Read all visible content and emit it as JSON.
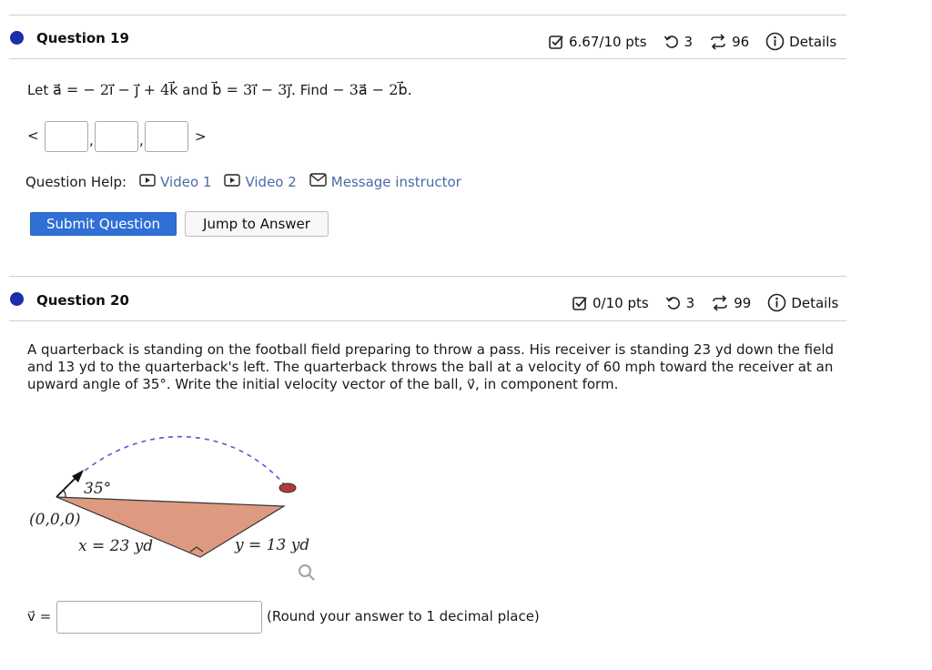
{
  "question19": {
    "title": "Question 19",
    "score": "6.67/10 pts",
    "attempts": "3",
    "submissions": "96",
    "details": "Details",
    "prompt_prefix": "Let ",
    "vector_a_expr": "a⃗ = − 2i⃗ − j⃗ + 4k⃗",
    "and_word": " and ",
    "vector_b_expr": "b⃗ = 3i⃗ − 3j⃗.",
    "find_word": " Find ",
    "find_expr": "− 3a⃗ − 2b⃗.",
    "open_bracket": "<",
    "comma": ",",
    "close_bracket": ">",
    "answer_values": [
      "",
      "",
      ""
    ],
    "help_label": "Question Help:",
    "help_links": [
      "Video 1",
      "Video 2",
      "Message instructor"
    ],
    "submit_label": "Submit Question",
    "jump_label": "Jump to Answer"
  },
  "question20": {
    "title": "Question 20",
    "score": "0/10 pts",
    "attempts": "3",
    "submissions": "99",
    "details": "Details",
    "problem_text": "A quarterback is standing on the football field preparing to throw a pass. His receiver is standing 23 yd down the field and 13 yd to the quarterback's left. The quarterback throws the ball at a velocity of 60 mph toward the receiver at an upward angle of 35°. Write the initial velocity vector of the ball, v⃗, in component form.",
    "figure": {
      "angle_label": "35°",
      "origin_label": "(0,0,0)",
      "x_label": "x = 23 yd",
      "y_label": "y = 13 yd"
    },
    "answer_label": "v⃗ =",
    "answer_value": "",
    "round_note": "(Round your answer to 1 decimal place)"
  },
  "icons": {
    "score": "checkbox-icon",
    "attempts": "retry-icon",
    "submissions": "submissions-icon",
    "details": "info-icon",
    "video": "video-icon",
    "message": "mail-icon",
    "zoom": "magnifier-icon"
  },
  "colors": {
    "question_dot": "#1c2ea8",
    "primary_button": "#2f6fd6",
    "link": "#4c6aa8",
    "triangle_fill": "#dd9a80",
    "ball": "#b03a3a"
  }
}
